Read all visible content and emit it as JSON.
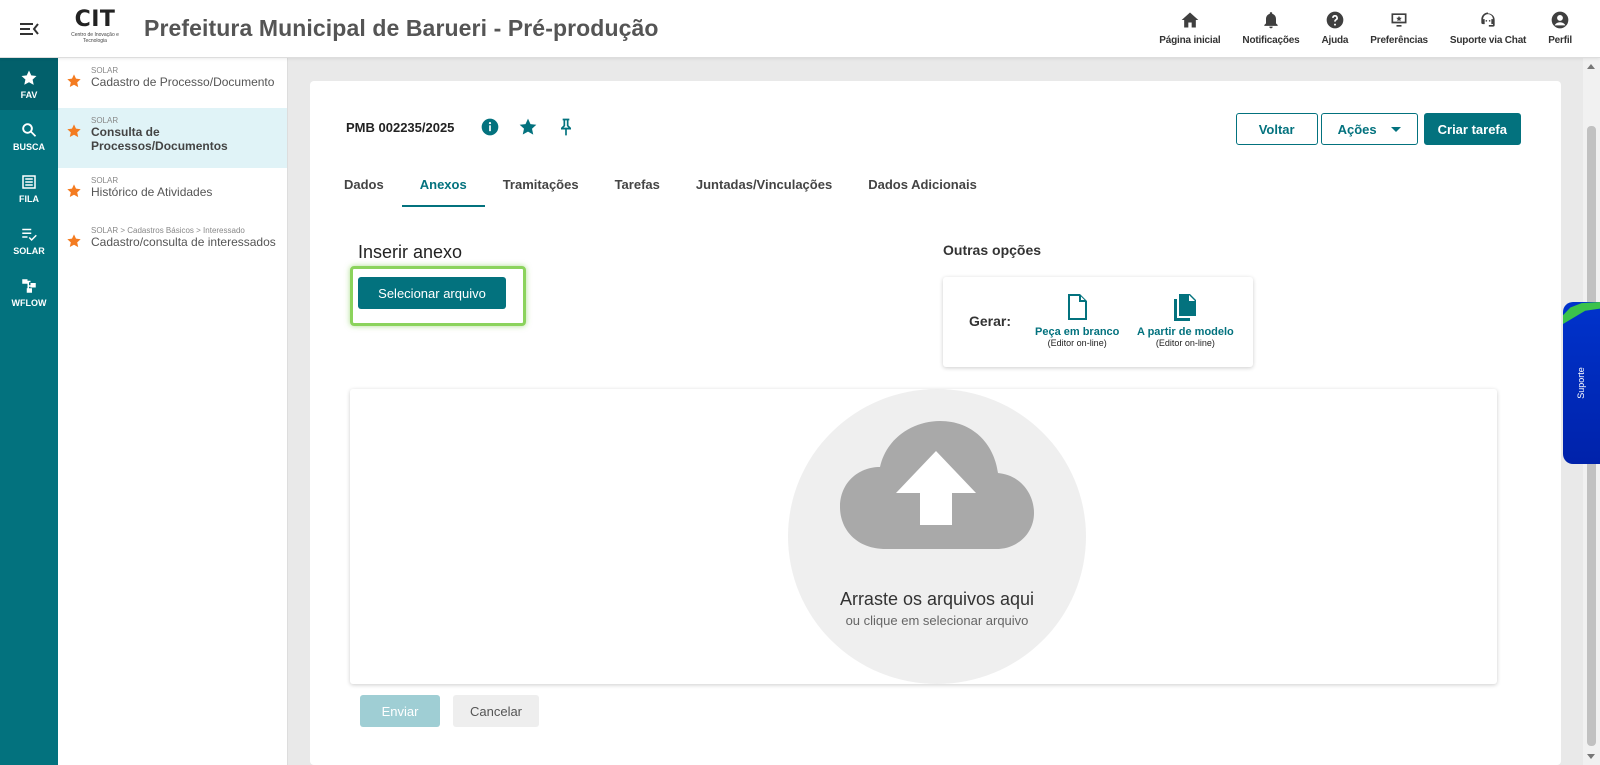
{
  "header": {
    "logo_text": "CIT",
    "logo_subtitle": "Centro de Inovação e Tecnologia",
    "title": "Prefeitura Municipal de Barueri - Pré-produção",
    "actions": [
      {
        "label": "Página inicial",
        "icon": "home-icon"
      },
      {
        "label": "Notificações",
        "icon": "bell-icon"
      },
      {
        "label": "Ajuda",
        "icon": "help-icon"
      },
      {
        "label": "Preferências",
        "icon": "preferences-icon"
      },
      {
        "label": "Suporte via Chat",
        "icon": "chat-support-icon"
      },
      {
        "label": "Perfil",
        "icon": "profile-icon"
      }
    ]
  },
  "rail": {
    "items": [
      {
        "label": "FAV",
        "icon": "star-icon",
        "active": true
      },
      {
        "label": "BUSCA",
        "icon": "search-icon"
      },
      {
        "label": "FILA",
        "icon": "list-icon"
      },
      {
        "label": "SOLAR",
        "icon": "checklist-icon"
      },
      {
        "label": "WFLOW",
        "icon": "workflow-icon"
      }
    ]
  },
  "favorites": [
    {
      "path": "SOLAR",
      "name": "Cadastro de Processo/Documento",
      "active": false
    },
    {
      "path": "SOLAR",
      "name": "Consulta de Processos/Documentos",
      "active": true
    },
    {
      "path": "SOLAR",
      "name": "Histórico de Atividades",
      "active": false
    },
    {
      "path": "SOLAR > Cadastros Básicos > Interessado",
      "name": "Cadastro/consulta de interessados",
      "active": false
    }
  ],
  "document": {
    "id": "PMB 002235/2025",
    "buttons": {
      "back": "Voltar",
      "actions": "Ações",
      "create_task": "Criar tarefa"
    },
    "tabs": [
      "Dados",
      "Anexos",
      "Tramitações",
      "Tarefas",
      "Juntadas/Vinculações",
      "Dados Adicionais"
    ],
    "active_tab": "Anexos"
  },
  "attach": {
    "title": "Inserir anexo",
    "select_button": "Selecionar arquivo",
    "other_title": "Outras opções",
    "generate_label": "Gerar:",
    "options": [
      {
        "label": "Peça em branco",
        "sub": "(Editor on-line)"
      },
      {
        "label": "A partir de modelo",
        "sub": "(Editor on-line)"
      }
    ],
    "drop_main": "Arraste os arquivos aqui",
    "drop_sub": "ou clique em selecionar arquivo",
    "send": "Enviar",
    "cancel": "Cancelar"
  },
  "support_tab": "Suporte",
  "colors": {
    "primary": "#03727e",
    "accent_star": "#f47b20",
    "highlight": "#8bd35c",
    "support": "#0033cc"
  }
}
